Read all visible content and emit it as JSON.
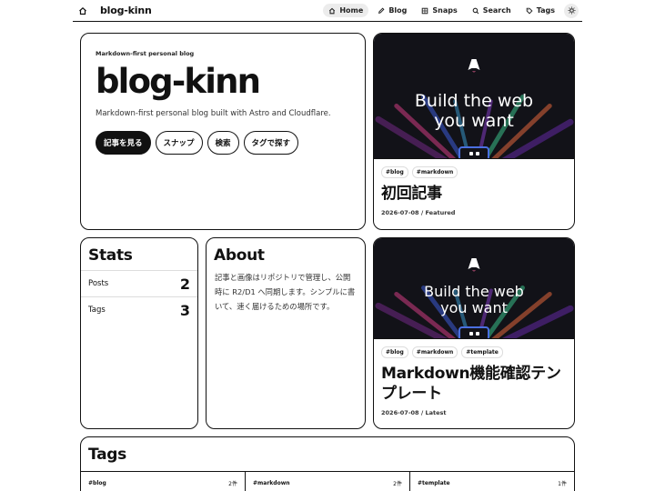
{
  "header": {
    "site_name": "blog-kinn",
    "nav": [
      {
        "label": "Home",
        "icon": "home-icon",
        "active": true
      },
      {
        "label": "Blog",
        "icon": "pen-icon",
        "active": false
      },
      {
        "label": "Snaps",
        "icon": "grid-icon",
        "active": false
      },
      {
        "label": "Search",
        "icon": "search-icon",
        "active": false
      },
      {
        "label": "Tags",
        "icon": "tag-icon",
        "active": false
      }
    ],
    "theme_toggle_icon": "sun-icon"
  },
  "hero": {
    "kicker": "Markdown-first personal blog",
    "title": "blog-kinn",
    "description": "Markdown-first personal blog built with Astro and Cloudflare.",
    "buttons": [
      "記事を見る",
      "スナップ",
      "検索",
      "タグで探す"
    ]
  },
  "posts": [
    {
      "thumb_text": [
        "Build the web",
        "you want"
      ],
      "tags": [
        "#blog",
        "#markdown"
      ],
      "title": "初回記事",
      "date": "2026-07-08",
      "label": "Featured"
    },
    {
      "thumb_text": [
        "Build the web",
        "you want"
      ],
      "tags": [
        "#blog",
        "#markdown",
        "#template"
      ],
      "title": "Markdown機能確認テンプレート",
      "date": "2026-07-08",
      "label": "Latest"
    }
  ],
  "stats": {
    "title": "Stats",
    "rows": [
      {
        "label": "Posts",
        "value": "2"
      },
      {
        "label": "Tags",
        "value": "3"
      }
    ]
  },
  "about": {
    "title": "About",
    "text": "記事と画像はリポジトリで管理し、公開時に R2/D1 へ同期します。シンプルに書いて、速く届けるための場所です。"
  },
  "tags": {
    "title": "Tags",
    "items": [
      {
        "name": "#blog",
        "count": "2件"
      },
      {
        "name": "#markdown",
        "count": "2件"
      },
      {
        "name": "#template",
        "count": "1件"
      }
    ]
  },
  "colors": {
    "ink": "#111111",
    "accent_blue": "#4a6fe0",
    "thumb_bg": "#121218"
  }
}
